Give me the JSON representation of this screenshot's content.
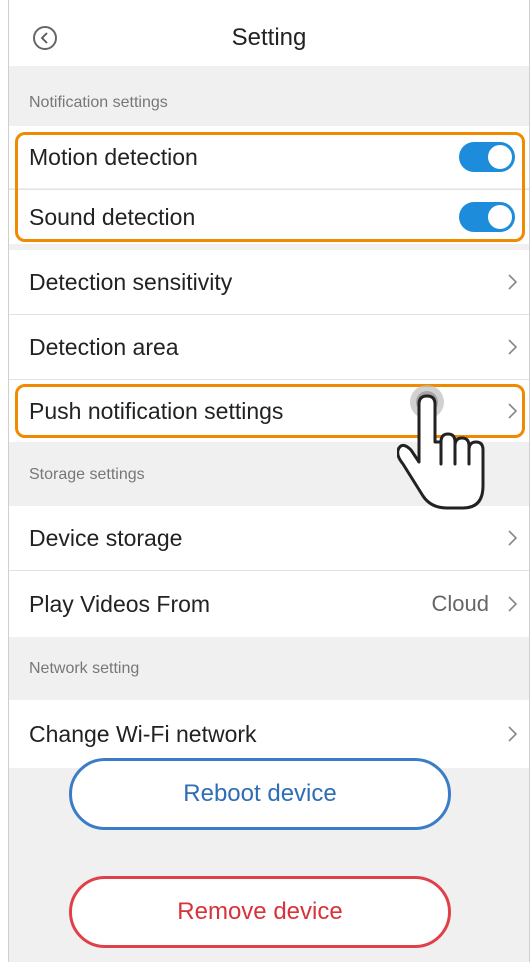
{
  "header": {
    "title": "Setting",
    "back_icon": "chevron-left-icon"
  },
  "sections": {
    "notification": "Notification settings",
    "storage": "Storage settings",
    "network": "Network setting"
  },
  "rows": {
    "motion": {
      "label": "Motion detection",
      "toggle_on": true
    },
    "sound": {
      "label": "Sound detection",
      "toggle_on": true
    },
    "sensitivity": {
      "label": "Detection sensitivity"
    },
    "area": {
      "label": "Detection area"
    },
    "push": {
      "label": "Push notification settings"
    },
    "device_storage": {
      "label": "Device storage"
    },
    "play_from": {
      "label": "Play Videos From",
      "value": "Cloud"
    },
    "wifi": {
      "label": "Change Wi-Fi network"
    }
  },
  "buttons": {
    "reboot": "Reboot device",
    "remove": "Remove device"
  },
  "colors": {
    "highlight": "#f08a00",
    "toggle_on": "#1c8cdb",
    "reboot": "#3a7cc7",
    "remove": "#e04048"
  },
  "overlay_icon": "pointing-hand-cursor-icon"
}
